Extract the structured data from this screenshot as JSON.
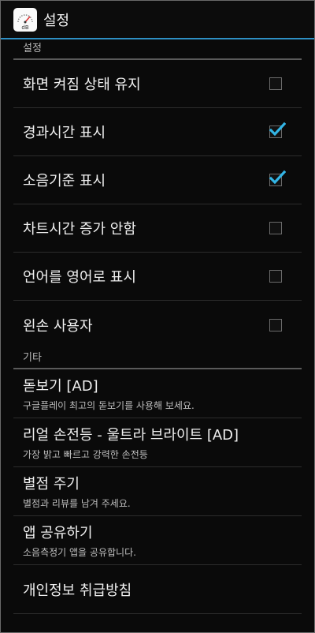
{
  "actionbar": {
    "title": "설정",
    "icon": "decibel-meter-icon",
    "icon_text": "dB"
  },
  "sections": {
    "settings": {
      "header": "설정",
      "items": [
        {
          "label": "화면 켜짐 상태 유지",
          "checked": false
        },
        {
          "label": "경과시간 표시",
          "checked": true
        },
        {
          "label": "소음기준 표시",
          "checked": true
        },
        {
          "label": "차트시간 증가 안함",
          "checked": false
        },
        {
          "label": "언어를 영어로 표시",
          "checked": false
        },
        {
          "label": "왼손 사용자",
          "checked": false
        }
      ]
    },
    "other": {
      "header": "기타",
      "items": [
        {
          "label": "돋보기 [AD]",
          "summary": "구글플레이 최고의 돋보기를 사용해 보세요."
        },
        {
          "label": "리얼 손전등 - 울트라 브라이트 [AD]",
          "summary": "가장 밝고 빠르고 강력한 손전등"
        },
        {
          "label": "별점 주기",
          "summary": "별점과 리뷰를 남겨 주세요."
        },
        {
          "label": "앱 공유하기",
          "summary": "소음측정기 앱을 공유합니다."
        },
        {
          "label": "개인정보 취급방침"
        }
      ]
    }
  },
  "colors": {
    "accent": "#2e8fc4",
    "check": "#33b5e5",
    "background": "#0a0a0a"
  }
}
